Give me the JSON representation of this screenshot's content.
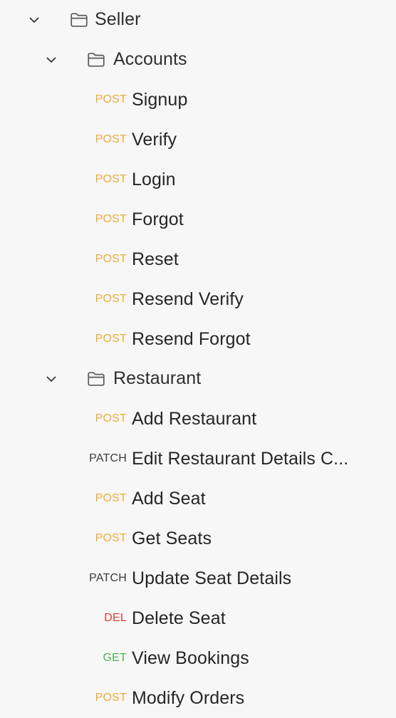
{
  "panel": {
    "name": "api-collection-tree",
    "background_color": "#f7f7f7",
    "method_colors": {
      "POST": "#edab39",
      "PATCH": "#3c3c3c",
      "DEL": "#e03b30",
      "GET": "#4cb050"
    }
  },
  "tree": [
    {
      "type": "folder",
      "depth": 0,
      "label": "Seller",
      "expanded": true,
      "chevron_icon": "chevron-down-icon",
      "folder_icon": "folder-icon"
    },
    {
      "type": "folder",
      "depth": 1,
      "label": "Accounts",
      "expanded": true,
      "chevron_icon": "chevron-down-icon",
      "folder_icon": "folder-icon"
    },
    {
      "type": "request",
      "method": "POST",
      "label": "Signup"
    },
    {
      "type": "request",
      "method": "POST",
      "label": "Verify"
    },
    {
      "type": "request",
      "method": "POST",
      "label": "Login"
    },
    {
      "type": "request",
      "method": "POST",
      "label": "Forgot"
    },
    {
      "type": "request",
      "method": "POST",
      "label": "Reset"
    },
    {
      "type": "request",
      "method": "POST",
      "label": "Resend Verify"
    },
    {
      "type": "request",
      "method": "POST",
      "label": "Resend Forgot"
    },
    {
      "type": "folder",
      "depth": 1,
      "label": "Restaurant",
      "expanded": true,
      "chevron_icon": "chevron-down-icon",
      "folder_icon": "folder-icon"
    },
    {
      "type": "request",
      "method": "POST",
      "label": "Add Restaurant"
    },
    {
      "type": "request",
      "method": "PATCH",
      "label": "Edit Restaurant Details C..."
    },
    {
      "type": "request",
      "method": "POST",
      "label": "Add Seat"
    },
    {
      "type": "request",
      "method": "POST",
      "label": "Get Seats"
    },
    {
      "type": "request",
      "method": "PATCH",
      "label": "Update Seat Details"
    },
    {
      "type": "request",
      "method": "DEL",
      "label": "Delete Seat"
    },
    {
      "type": "request",
      "method": "GET",
      "label": "View Bookings"
    },
    {
      "type": "request",
      "method": "POST",
      "label": "Modify Orders"
    }
  ]
}
